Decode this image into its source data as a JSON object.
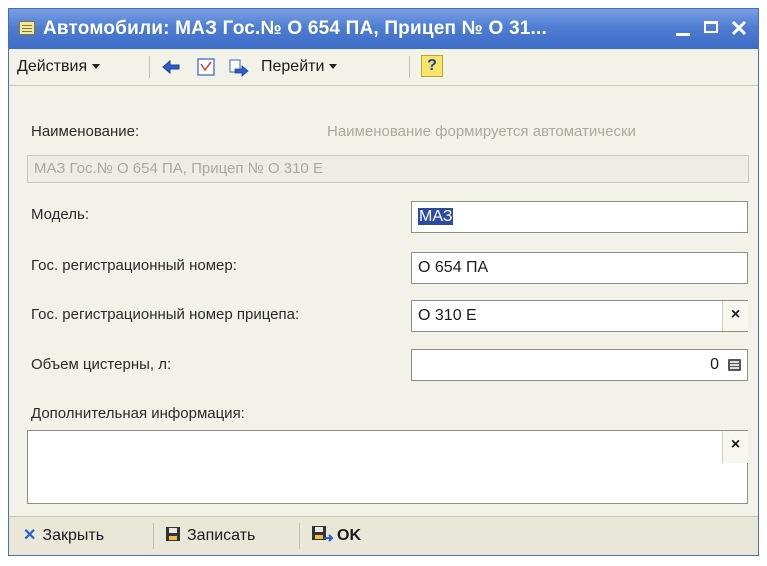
{
  "window": {
    "title": "Автомобили: МАЗ Гос.№ О 654 ПА, Прицеп № О 31...",
    "minimize_label": "",
    "maximize_label": "",
    "close_label": "✕"
  },
  "toolbar": {
    "actions_label": "Действия",
    "goto_label": "Перейти",
    "help_label": "?"
  },
  "form": {
    "name_label": "Наименование:",
    "name_note": "Наименование формируется автоматически",
    "name_value": "МАЗ Гос.№ О 654 ПА, Прицеп № О 310 Е",
    "model_label": "Модель:",
    "model_value": "МАЗ",
    "reg_number_label": "Гос. регистрационный номер:",
    "reg_number_value": "О 654 ПА",
    "trailer_reg_label": "Гос. регистрационный номер прицепа:",
    "trailer_reg_value": "О 310 Е",
    "tank_volume_label": "Объем цистерны, л:",
    "tank_volume_value": "0",
    "extra_info_label": "Дополнительная информация:",
    "extra_info_value": "",
    "clear_symbol": "×"
  },
  "bottombar": {
    "close_label": "Закрыть",
    "save_label": "Записать",
    "ok_label": "OK"
  },
  "colors": {
    "title_bar": "#4f7dd3",
    "window_bg": "#f3f2e8",
    "selection": "#2d4aa3"
  }
}
